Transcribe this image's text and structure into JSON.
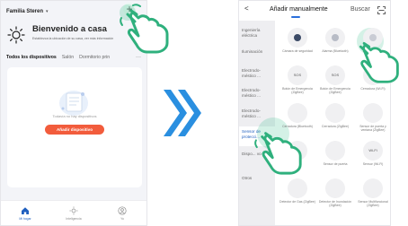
{
  "left_screen": {
    "family_name": "Familia Steren",
    "add_symbol": "+",
    "welcome_title": "Bienvenido a casa",
    "welcome_subtitle": "Establezca la ubicación de su casa, ver más información",
    "tabs": [
      "Todos los dispositivos",
      "Salón",
      "Dormitorio prin"
    ],
    "tabs_more": "···",
    "empty_text": "Todavía no hay dispositivos",
    "add_device_label": "Añadir dispositivo",
    "nav": [
      "Mi hogar",
      "Inteligencia",
      "Yo"
    ]
  },
  "right_screen": {
    "back_symbol": "<",
    "tab_manual": "Añadir manualmente",
    "tab_search": "Buscar",
    "categories": [
      "Ingeniería eléctrica",
      "Iluminación",
      "Electrodo-méstico ...",
      "Electrodo-méstico ...",
      "Electrodo-méstico ...",
      "Sensor de protecci...",
      "Dispo... vo port...",
      "Otros"
    ],
    "active_category_index": 5,
    "devices": [
      {
        "label": "Cámara de seguridad",
        "mini": ""
      },
      {
        "label": "Alarma (Bluetooth)",
        "mini": ""
      },
      {
        "label": "Alarma (Wi-Fi)",
        "mini": ""
      },
      {
        "label": "Botón de Emergencia (ZigBee)",
        "mini": "SOS"
      },
      {
        "label": "Botón de Emergencia (ZigBee)",
        "mini": "SOS"
      },
      {
        "label": "Cerradura (Wi-Fi)",
        "mini": ""
      },
      {
        "label": "Cerradura (Bluetooth)",
        "mini": ""
      },
      {
        "label": "Cerradura (ZigBee)",
        "mini": ""
      },
      {
        "label": "Sensor de puerta y ventana (ZigBee)",
        "mini": ""
      },
      {
        "label": "",
        "mini": ""
      },
      {
        "label": "Sensor de puerta",
        "mini": ""
      },
      {
        "label": "Sensor (Wi-Fi)",
        "mini": "Wi-Fi"
      },
      {
        "label": "Detector de Gas (ZigBee)",
        "mini": ""
      },
      {
        "label": "Detector de Inundación (ZigBee)",
        "mini": ""
      },
      {
        "label": "Sensor Multifuncional (ZigBee)",
        "mini": ""
      }
    ]
  },
  "colors": {
    "accent_orange": "#f25c3c",
    "accent_blue": "#1f5fbf",
    "arrow_blue": "#2a8fe0",
    "hand_green": "#2fb07d",
    "highlight_green": "#3cbe8c"
  }
}
